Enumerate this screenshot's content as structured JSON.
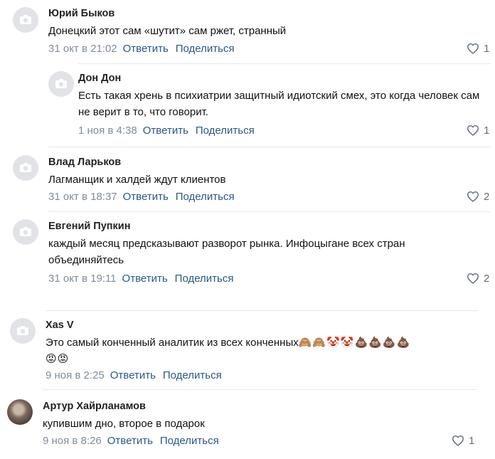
{
  "comments": [
    {
      "author": "Юрий Быков",
      "text": "Донецкий этот сам «шутит» сам ржет, странный",
      "date": "31 окт в 21:02",
      "reply_label": "Ответить",
      "share_label": "Поделиться",
      "likes": "1"
    },
    {
      "author": "Дон Дон",
      "text": "Есть такая хрень в психиатрии защитный идиотский смех, это когда человек сам не верит в то, что говорит.",
      "date": "1 ноя в 4:38",
      "reply_label": "Ответить",
      "share_label": "Поделиться",
      "likes": "1"
    },
    {
      "author": "Влад Ларьков",
      "text": "Лагманщик и халдей ждут клиентов",
      "date": "31 окт в 18:37",
      "reply_label": "Ответить",
      "share_label": "Поделиться",
      "likes": "2"
    },
    {
      "author": "Евгений Пупкин",
      "text": "каждый месяц предсказывают разворот рынка. Инфоцыгане всех стран объединяйтесь",
      "date": "31 окт в 19:11",
      "reply_label": "Ответить",
      "share_label": "Поделиться",
      "likes": "2"
    },
    {
      "author": "Xas V",
      "text": "Это самый конченный аналитик из всех конченных",
      "emoji_line1": "🙈🙈🤡🤡💩💩💩💩",
      "emoji_line2": "😡😡",
      "date": "9 ноя в 2:25",
      "reply_label": "Ответить",
      "share_label": "Поделиться"
    },
    {
      "author": "Артур Хайрланамов",
      "text": "купившим дно, второе в подарок",
      "date": "9 ноя в 8:26",
      "reply_label": "Ответить",
      "share_label": "Поделиться",
      "likes": "1"
    }
  ],
  "icons": {
    "heart": "heart-icon",
    "avatar_placeholder": "camera-icon"
  },
  "colors": {
    "link": "#2a5885",
    "meta": "#818c99",
    "avatar_bg": "#e1e3e6",
    "divider": "#e7e8ec"
  }
}
